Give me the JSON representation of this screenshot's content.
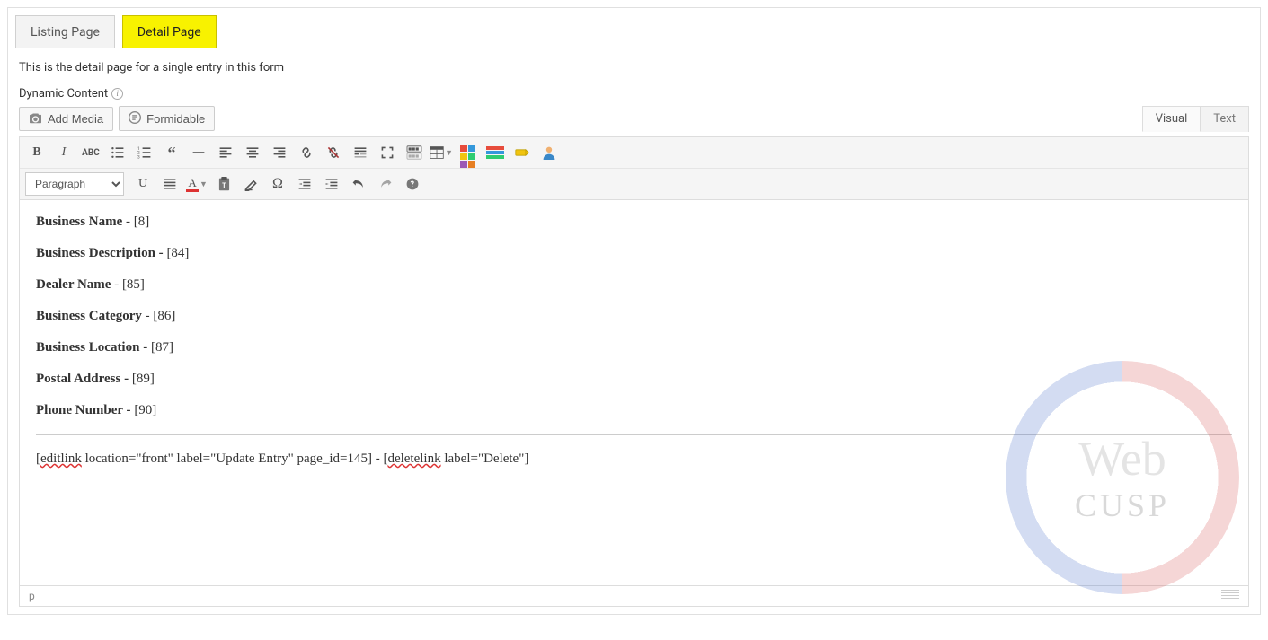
{
  "tabs": {
    "listing": "Listing Page",
    "detail": "Detail Page"
  },
  "description": "This is the detail page for a single entry in this form",
  "section_label": "Dynamic Content",
  "buttons": {
    "add_media": "Add Media",
    "formidable": "Formidable"
  },
  "mode_tabs": {
    "visual": "Visual",
    "text": "Text"
  },
  "format_select": "Paragraph",
  "content": {
    "line1_label": "Business Name",
    "line1_sep": " - ",
    "line1_val": "[8]",
    "line2_label": "Business Description - ",
    "line2_val": "[84]",
    "line3_label": "Dealer Name",
    "line3_sep": " - ",
    "line3_val": "[85]",
    "line4_label": "Business Category",
    "line4_sep": " - ",
    "line4_val": "[86]",
    "line5_label": "Business Location",
    "line5_sep": " - ",
    "line5_val": "[87]",
    "line6_label": "Postal Address - ",
    "line6_val": "[89]",
    "line7_label": "Phone Number - ",
    "line7_val": "[90]",
    "shortcode_pre": "[",
    "shortcode_editlink": "editlink",
    "shortcode_mid": " location=\"front\" label=\"Update Entry\" page_id=145] - [",
    "shortcode_deletelink": "deletelink",
    "shortcode_post": " label=\"Delete\"]"
  },
  "status": {
    "path": "p"
  },
  "watermark": {
    "line1": "Web",
    "line2": "CUSP"
  }
}
